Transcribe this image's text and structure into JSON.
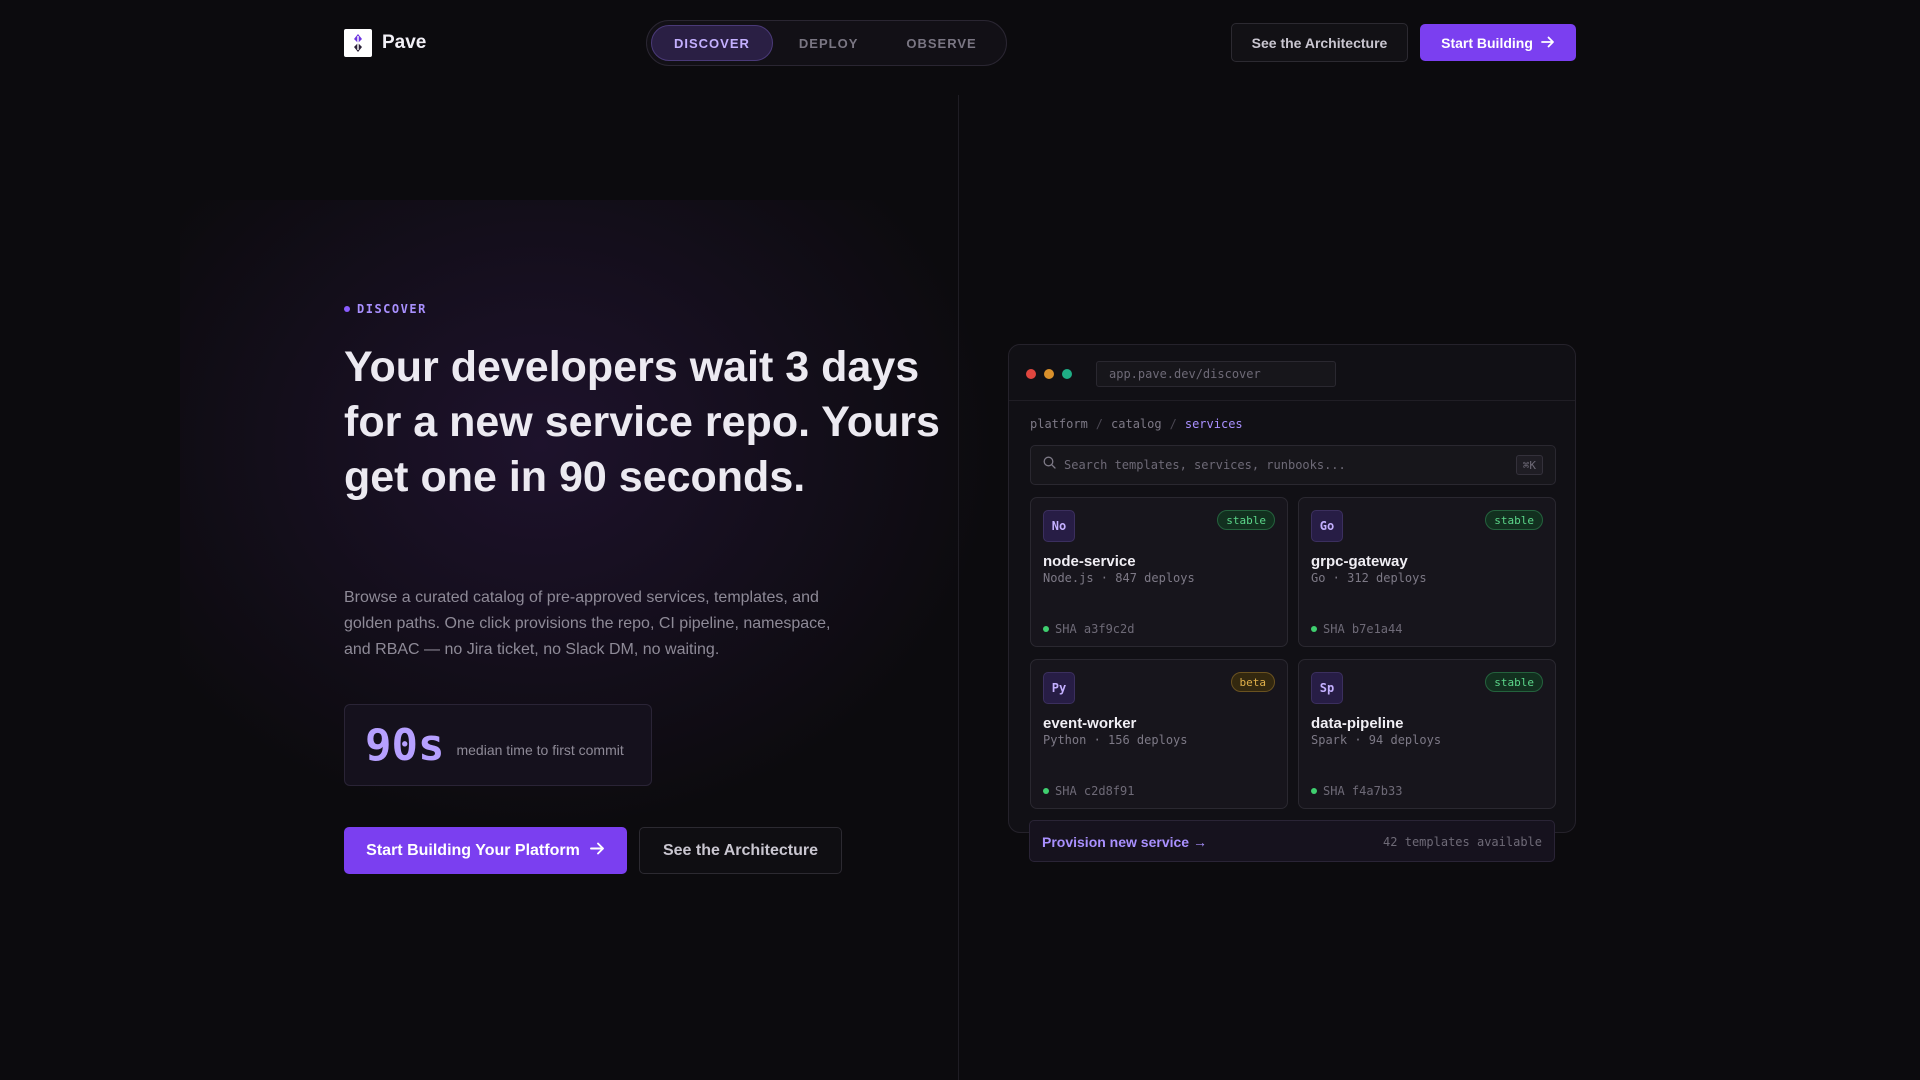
{
  "brand": {
    "name": "Pave"
  },
  "nav": {
    "tabs": [
      {
        "label": "DISCOVER",
        "active": true
      },
      {
        "label": "DEPLOY",
        "active": false
      },
      {
        "label": "OBSERVE",
        "active": false
      }
    ],
    "architecture_label": "See the Architecture",
    "start_label": "Start Building"
  },
  "hero": {
    "eyebrow": "DISCOVER",
    "headline": "Your developers wait 3 days for a new service repo. Yours get one in 90 seconds.",
    "subtext": "Browse a curated catalog of pre-approved services, templates, and golden paths. One click provisions the repo, CI pipeline, namespace, and RBAC — no Jira ticket, no Slack DM, no waiting.",
    "stat_value": "90s",
    "stat_label": "median time to first commit",
    "cta_primary": "Start Building Your Platform",
    "cta_secondary": "See the Architecture"
  },
  "mock": {
    "url": "app.pave.dev/discover",
    "breadcrumbs": [
      "platform",
      "catalog",
      "services"
    ],
    "search_placeholder": "Search templates, services, runbooks...",
    "search_shortcut": "⌘K",
    "cards": [
      {
        "abbr": "No",
        "name": "node-service",
        "meta": "Node.js · 847 deploys",
        "badge": "stable",
        "sha": "SHA a3f9c2d"
      },
      {
        "abbr": "Go",
        "name": "grpc-gateway",
        "meta": "Go · 312 deploys",
        "badge": "stable",
        "sha": "SHA b7e1a44"
      },
      {
        "abbr": "Py",
        "name": "event-worker",
        "meta": "Python · 156 deploys",
        "badge": "beta",
        "sha": "SHA c2d8f91"
      },
      {
        "abbr": "Sp",
        "name": "data-pipeline",
        "meta": "Spark · 94 deploys",
        "badge": "stable",
        "sha": "SHA f4a7b33"
      }
    ],
    "footer_link": "Provision new service →",
    "footer_count": "42 templates available"
  },
  "colors": {
    "accent": "#7b3ff0",
    "accent_text": "#a990ff",
    "stable": "#5cd68a",
    "beta": "#e0b04a",
    "window_red": "#e0463f",
    "window_yellow": "#d9902b",
    "window_green": "#1fae85"
  }
}
